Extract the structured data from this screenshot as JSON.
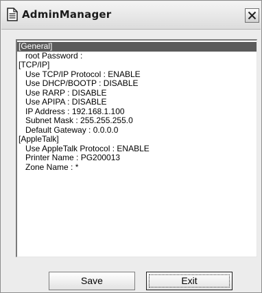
{
  "window": {
    "title": "AdminManager",
    "close_label": "×"
  },
  "list": {
    "items": [
      {
        "text": "[General]",
        "indent": false,
        "selected": true
      },
      {
        "text": "root Password :",
        "indent": true,
        "selected": false
      },
      {
        "text": "[TCP/IP]",
        "indent": false,
        "selected": false
      },
      {
        "text": "Use TCP/IP Protocol : ENABLE",
        "indent": true,
        "selected": false
      },
      {
        "text": "Use DHCP/BOOTP : DISABLE",
        "indent": true,
        "selected": false
      },
      {
        "text": "Use RARP : DISABLE",
        "indent": true,
        "selected": false
      },
      {
        "text": "Use APIPA : DISABLE",
        "indent": true,
        "selected": false
      },
      {
        "text": "IP Address : 192.168.1.100",
        "indent": true,
        "selected": false
      },
      {
        "text": "Subnet Mask : 255.255.255.0",
        "indent": true,
        "selected": false
      },
      {
        "text": "Default Gateway : 0.0.0.0",
        "indent": true,
        "selected": false
      },
      {
        "text": "[AppleTalk]",
        "indent": false,
        "selected": false
      },
      {
        "text": "Use AppleTalk Protocol : ENABLE",
        "indent": true,
        "selected": false
      },
      {
        "text": "Printer Name : PG200013",
        "indent": true,
        "selected": false
      },
      {
        "text": "Zone Name : *",
        "indent": true,
        "selected": false
      }
    ]
  },
  "buttons": {
    "save_label": "Save",
    "exit_label": "Exit"
  }
}
